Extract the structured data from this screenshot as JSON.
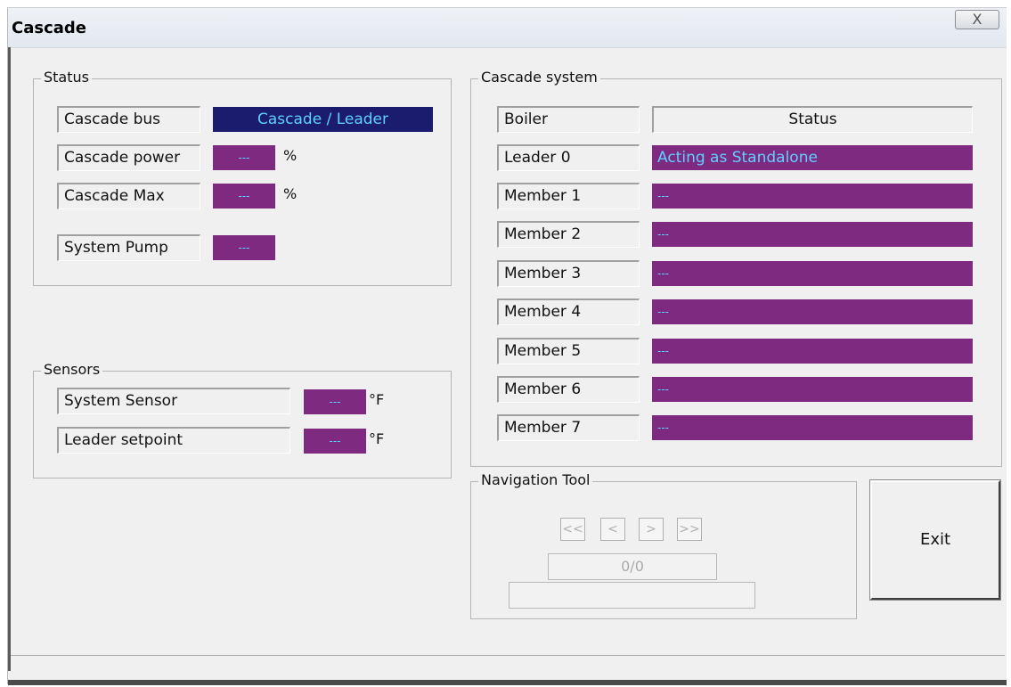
{
  "window": {
    "title": "Cascade",
    "close_label": "X"
  },
  "status": {
    "legend": "Status",
    "cascade_bus": {
      "label": "Cascade bus",
      "value": "Cascade / Leader"
    },
    "cascade_power": {
      "label": "Cascade power",
      "value": "---",
      "unit": "%"
    },
    "cascade_max": {
      "label": "Cascade Max",
      "value": "---",
      "unit": "%"
    },
    "system_pump": {
      "label": "System Pump",
      "value": "---"
    }
  },
  "sensors": {
    "legend": "Sensors",
    "system_sensor": {
      "label": "System Sensor",
      "value": "---",
      "unit": "°F"
    },
    "leader_setpoint": {
      "label": "Leader setpoint",
      "value": "---",
      "unit": "°F"
    }
  },
  "cascade_system": {
    "legend": "Cascade system",
    "header_boiler": "Boiler",
    "header_status": "Status",
    "rows": [
      {
        "boiler": "Leader 0",
        "status": "Acting as Standalone"
      },
      {
        "boiler": "Member 1",
        "status": "---"
      },
      {
        "boiler": "Member 2",
        "status": "---"
      },
      {
        "boiler": "Member 3",
        "status": "---"
      },
      {
        "boiler": "Member 4",
        "status": "---"
      },
      {
        "boiler": "Member 5",
        "status": "---"
      },
      {
        "boiler": "Member 6",
        "status": "---"
      },
      {
        "boiler": "Member 7",
        "status": "---"
      }
    ]
  },
  "navigation": {
    "legend": "Navigation Tool",
    "first": "<<",
    "prev": "<",
    "next": ">",
    "last": ">>",
    "counter": "0/0",
    "info": ""
  },
  "exit_label": "Exit",
  "colors": {
    "value_bg": "#7e2a80",
    "leader_bg": "#1b1c6e",
    "value_text": "#5fd0ff"
  }
}
